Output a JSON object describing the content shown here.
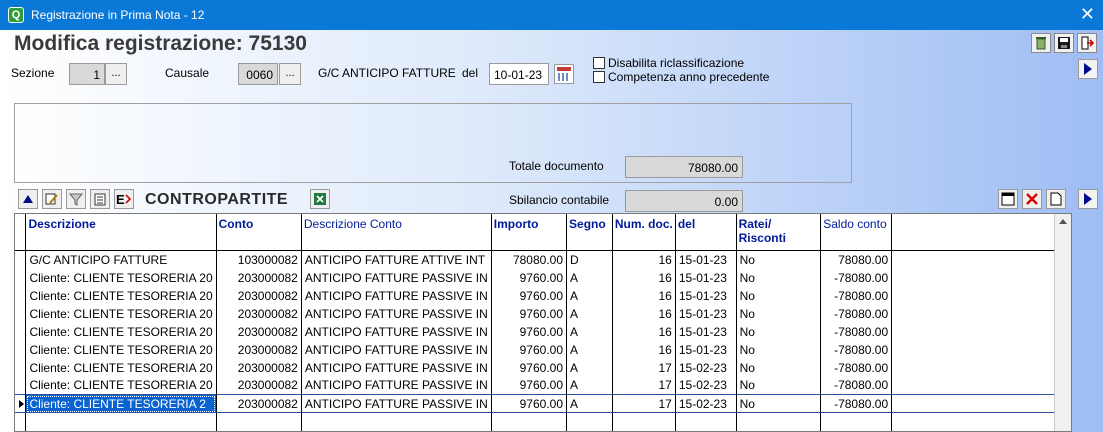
{
  "window": {
    "title": "Registrazione in Prima Nota - 12",
    "close_glyph": "✕"
  },
  "heading": "Modifica registrazione:  75130",
  "header": {
    "sezione_label": "Sezione",
    "sezione_value": "1",
    "causale_label": "Causale",
    "causale_value": "0060",
    "causale_desc": "G/C ANTICIPO FATTURE",
    "del_label": "del",
    "del_value": "10-01-23",
    "ellipsis": "...",
    "chk_disabilita": "Disabilita riclassificazione",
    "chk_competenza": "Competenza anno precedente"
  },
  "totals": {
    "totale_label": "Totale documento",
    "totale_value": "78080.00",
    "sbilancio_label": "Sbilancio contabile",
    "sbilancio_value": "0.00"
  },
  "contropartite_title": "CONTROPARTITE",
  "toolbar_icons": [
    "recycle-icon",
    "save-icon",
    "exit-icon",
    "arrow-up-icon",
    "edit-icon",
    "filter-icon",
    "list-icon",
    "export-icon",
    "excel-icon",
    "window-icon",
    "delete-icon",
    "new-document-icon"
  ],
  "table": {
    "headers": [
      "Descrizione",
      "Conto",
      "Descrizione Conto",
      "Importo",
      "Segno",
      "Num. doc.",
      "del",
      "Ratei/ Risconti",
      "Saldo conto"
    ],
    "rows": [
      [
        "G/C ANTICIPO FATTURE",
        "103000082",
        "ANTICIPO FATTURE ATTIVE INT",
        "78080.00",
        "D",
        "16",
        "15-01-23",
        "No",
        "78080.00"
      ],
      [
        "Cliente: CLIENTE TESORERIA 20",
        "203000082",
        "ANTICIPO FATTURE PASSIVE IN",
        "9760.00",
        "A",
        "16",
        "15-01-23",
        "No",
        "-78080.00"
      ],
      [
        "Cliente: CLIENTE TESORERIA 20",
        "203000082",
        "ANTICIPO FATTURE PASSIVE IN",
        "9760.00",
        "A",
        "16",
        "15-01-23",
        "No",
        "-78080.00"
      ],
      [
        "Cliente: CLIENTE TESORERIA 20",
        "203000082",
        "ANTICIPO FATTURE PASSIVE IN",
        "9760.00",
        "A",
        "16",
        "15-01-23",
        "No",
        "-78080.00"
      ],
      [
        "Cliente: CLIENTE TESORERIA 20",
        "203000082",
        "ANTICIPO FATTURE PASSIVE IN",
        "9760.00",
        "A",
        "16",
        "15-01-23",
        "No",
        "-78080.00"
      ],
      [
        "Cliente: CLIENTE TESORERIA 20",
        "203000082",
        "ANTICIPO FATTURE PASSIVE IN",
        "9760.00",
        "A",
        "16",
        "15-01-23",
        "No",
        "-78080.00"
      ],
      [
        "Cliente: CLIENTE TESORERIA 20",
        "203000082",
        "ANTICIPO FATTURE PASSIVE IN",
        "9760.00",
        "A",
        "17",
        "15-02-23",
        "No",
        "-78080.00"
      ],
      [
        "Cliente: CLIENTE TESORERIA 20",
        "203000082",
        "ANTICIPO FATTURE PASSIVE IN",
        "9760.00",
        "A",
        "17",
        "15-02-23",
        "No",
        "-78080.00"
      ],
      [
        "Cliente: CLIENTE TESORERIA 2",
        "203000082",
        "ANTICIPO FATTURE PASSIVE IN",
        "9760.00",
        "A",
        "17",
        "15-02-23",
        "No",
        "-78080.00"
      ]
    ],
    "selected_row": 8
  }
}
